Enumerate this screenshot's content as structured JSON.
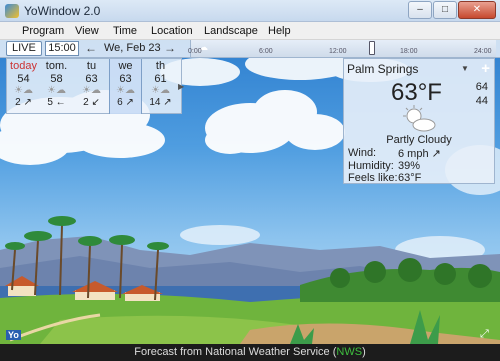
{
  "window": {
    "title": "YoWindow 2.0",
    "buttons": [
      "–",
      "□",
      "✕"
    ]
  },
  "menu": [
    "Program",
    "View",
    "Time",
    "Location",
    "Landscape",
    "Help"
  ],
  "timebar": {
    "live": "LIVE",
    "time": "15:00",
    "prev": "←",
    "next": "→",
    "date": "We, Feb 23",
    "ticks": [
      "0:00",
      "6:00",
      "12:00",
      "18:00",
      "24:00"
    ]
  },
  "forecast": {
    "days": [
      {
        "name": "today",
        "temp": "54",
        "wind": "2 ↗",
        "icon": "partly-cloudy-icon"
      },
      {
        "name": "tom.",
        "temp": "58",
        "wind": "5 ←",
        "icon": "partly-cloudy-icon"
      },
      {
        "name": "tu",
        "temp": "63",
        "wind": "2 ↙",
        "icon": "partly-cloudy-icon"
      },
      {
        "name": "we",
        "temp": "63",
        "wind": "6 ↗",
        "icon": "partly-cloudy-icon"
      },
      {
        "name": "th",
        "temp": "61",
        "wind": "14 ↗",
        "icon": "partly-cloudy-icon"
      }
    ],
    "selected_index": 3,
    "expand": "▶"
  },
  "location": {
    "name": "Palm Springs",
    "dropdown": "▼",
    "add": "+",
    "temp": "63°F",
    "high": "64",
    "low": "44",
    "condition": "Partly Cloudy",
    "wind_label": "Wind:",
    "wind_value": "6 mph  ↗",
    "humidity_label": "Humidity:",
    "humidity_value": "39%",
    "feels_label": "Feels like:",
    "feels_value": "63°F"
  },
  "status": {
    "prefix": "Forecast from National Weather Service (",
    "source": "NWS",
    "suffix": ")"
  },
  "brand": "Yo",
  "fullscreen": "⤢"
}
